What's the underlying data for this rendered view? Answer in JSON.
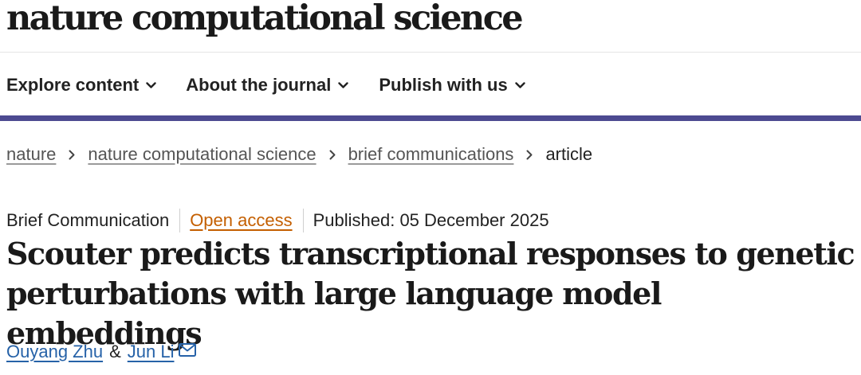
{
  "header": {
    "logo_text": "nature computational science"
  },
  "nav": {
    "items": [
      {
        "label": "Explore content"
      },
      {
        "label": "About the journal"
      },
      {
        "label": "Publish with us"
      }
    ]
  },
  "breadcrumb": {
    "items": [
      {
        "label": "nature"
      },
      {
        "label": "nature computational science"
      },
      {
        "label": "brief communications"
      }
    ],
    "current": "article"
  },
  "article": {
    "type": "Brief Communication",
    "access": "Open access",
    "published": "Published: 05 December 2025",
    "title": "Scouter predicts transcriptional responses to genetic perturbations with large language model embeddings",
    "authors": [
      {
        "name": "Ouyang Zhu"
      },
      {
        "name": "Jun Li"
      }
    ],
    "author_separator": "&"
  },
  "colors": {
    "accent": "#4d4a91",
    "link": "#2662a8",
    "open_access": "#c45f00"
  },
  "icons": {
    "nav_chevron": "chevron-down-icon",
    "breadcrumb_separator": "chevron-right-icon",
    "corresponding_author": "envelope-icon"
  }
}
